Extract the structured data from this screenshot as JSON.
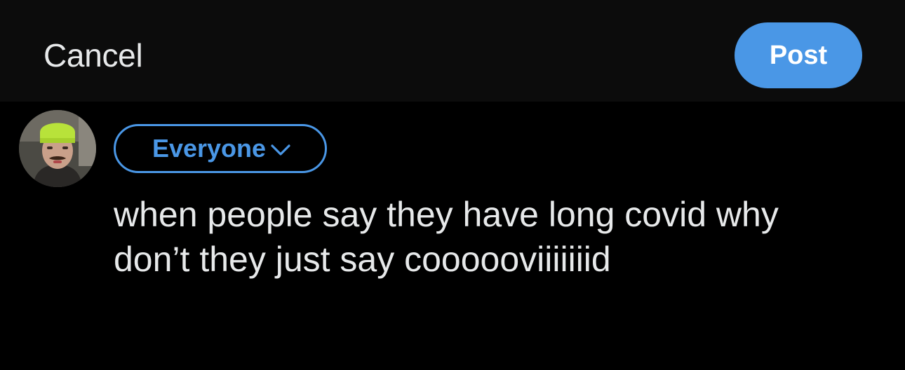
{
  "header": {
    "cancel_label": "Cancel",
    "post_label": "Post"
  },
  "composer": {
    "avatar_icon": "user-avatar",
    "audience_label": "Everyone",
    "audience_icon": "chevron-down-icon",
    "text": "when people say they have long covid why\ndon’t they just say cooooovіііііiid"
  },
  "colors": {
    "accent": "#4a97e6",
    "background": "#000000",
    "header_background": "#0c0c0c",
    "text": "#e7e9ea"
  }
}
